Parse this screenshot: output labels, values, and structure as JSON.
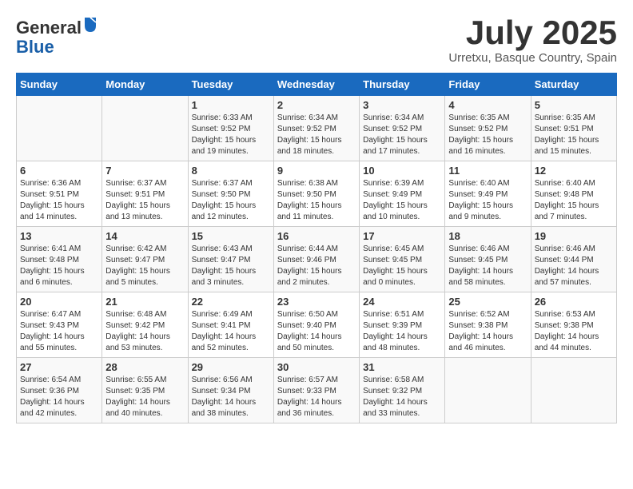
{
  "header": {
    "logo_line1": "General",
    "logo_line2": "Blue",
    "month_title": "July 2025",
    "subtitle": "Urretxu, Basque Country, Spain"
  },
  "weekdays": [
    "Sunday",
    "Monday",
    "Tuesday",
    "Wednesday",
    "Thursday",
    "Friday",
    "Saturday"
  ],
  "weeks": [
    [
      {
        "day": "",
        "sunrise": "",
        "sunset": "",
        "daylight": ""
      },
      {
        "day": "",
        "sunrise": "",
        "sunset": "",
        "daylight": ""
      },
      {
        "day": "1",
        "sunrise": "Sunrise: 6:33 AM",
        "sunset": "Sunset: 9:52 PM",
        "daylight": "Daylight: 15 hours and 19 minutes."
      },
      {
        "day": "2",
        "sunrise": "Sunrise: 6:34 AM",
        "sunset": "Sunset: 9:52 PM",
        "daylight": "Daylight: 15 hours and 18 minutes."
      },
      {
        "day": "3",
        "sunrise": "Sunrise: 6:34 AM",
        "sunset": "Sunset: 9:52 PM",
        "daylight": "Daylight: 15 hours and 17 minutes."
      },
      {
        "day": "4",
        "sunrise": "Sunrise: 6:35 AM",
        "sunset": "Sunset: 9:52 PM",
        "daylight": "Daylight: 15 hours and 16 minutes."
      },
      {
        "day": "5",
        "sunrise": "Sunrise: 6:35 AM",
        "sunset": "Sunset: 9:51 PM",
        "daylight": "Daylight: 15 hours and 15 minutes."
      }
    ],
    [
      {
        "day": "6",
        "sunrise": "Sunrise: 6:36 AM",
        "sunset": "Sunset: 9:51 PM",
        "daylight": "Daylight: 15 hours and 14 minutes."
      },
      {
        "day": "7",
        "sunrise": "Sunrise: 6:37 AM",
        "sunset": "Sunset: 9:51 PM",
        "daylight": "Daylight: 15 hours and 13 minutes."
      },
      {
        "day": "8",
        "sunrise": "Sunrise: 6:37 AM",
        "sunset": "Sunset: 9:50 PM",
        "daylight": "Daylight: 15 hours and 12 minutes."
      },
      {
        "day": "9",
        "sunrise": "Sunrise: 6:38 AM",
        "sunset": "Sunset: 9:50 PM",
        "daylight": "Daylight: 15 hours and 11 minutes."
      },
      {
        "day": "10",
        "sunrise": "Sunrise: 6:39 AM",
        "sunset": "Sunset: 9:49 PM",
        "daylight": "Daylight: 15 hours and 10 minutes."
      },
      {
        "day": "11",
        "sunrise": "Sunrise: 6:40 AM",
        "sunset": "Sunset: 9:49 PM",
        "daylight": "Daylight: 15 hours and 9 minutes."
      },
      {
        "day": "12",
        "sunrise": "Sunrise: 6:40 AM",
        "sunset": "Sunset: 9:48 PM",
        "daylight": "Daylight: 15 hours and 7 minutes."
      }
    ],
    [
      {
        "day": "13",
        "sunrise": "Sunrise: 6:41 AM",
        "sunset": "Sunset: 9:48 PM",
        "daylight": "Daylight: 15 hours and 6 minutes."
      },
      {
        "day": "14",
        "sunrise": "Sunrise: 6:42 AM",
        "sunset": "Sunset: 9:47 PM",
        "daylight": "Daylight: 15 hours and 5 minutes."
      },
      {
        "day": "15",
        "sunrise": "Sunrise: 6:43 AM",
        "sunset": "Sunset: 9:47 PM",
        "daylight": "Daylight: 15 hours and 3 minutes."
      },
      {
        "day": "16",
        "sunrise": "Sunrise: 6:44 AM",
        "sunset": "Sunset: 9:46 PM",
        "daylight": "Daylight: 15 hours and 2 minutes."
      },
      {
        "day": "17",
        "sunrise": "Sunrise: 6:45 AM",
        "sunset": "Sunset: 9:45 PM",
        "daylight": "Daylight: 15 hours and 0 minutes."
      },
      {
        "day": "18",
        "sunrise": "Sunrise: 6:46 AM",
        "sunset": "Sunset: 9:45 PM",
        "daylight": "Daylight: 14 hours and 58 minutes."
      },
      {
        "day": "19",
        "sunrise": "Sunrise: 6:46 AM",
        "sunset": "Sunset: 9:44 PM",
        "daylight": "Daylight: 14 hours and 57 minutes."
      }
    ],
    [
      {
        "day": "20",
        "sunrise": "Sunrise: 6:47 AM",
        "sunset": "Sunset: 9:43 PM",
        "daylight": "Daylight: 14 hours and 55 minutes."
      },
      {
        "day": "21",
        "sunrise": "Sunrise: 6:48 AM",
        "sunset": "Sunset: 9:42 PM",
        "daylight": "Daylight: 14 hours and 53 minutes."
      },
      {
        "day": "22",
        "sunrise": "Sunrise: 6:49 AM",
        "sunset": "Sunset: 9:41 PM",
        "daylight": "Daylight: 14 hours and 52 minutes."
      },
      {
        "day": "23",
        "sunrise": "Sunrise: 6:50 AM",
        "sunset": "Sunset: 9:40 PM",
        "daylight": "Daylight: 14 hours and 50 minutes."
      },
      {
        "day": "24",
        "sunrise": "Sunrise: 6:51 AM",
        "sunset": "Sunset: 9:39 PM",
        "daylight": "Daylight: 14 hours and 48 minutes."
      },
      {
        "day": "25",
        "sunrise": "Sunrise: 6:52 AM",
        "sunset": "Sunset: 9:38 PM",
        "daylight": "Daylight: 14 hours and 46 minutes."
      },
      {
        "day": "26",
        "sunrise": "Sunrise: 6:53 AM",
        "sunset": "Sunset: 9:38 PM",
        "daylight": "Daylight: 14 hours and 44 minutes."
      }
    ],
    [
      {
        "day": "27",
        "sunrise": "Sunrise: 6:54 AM",
        "sunset": "Sunset: 9:36 PM",
        "daylight": "Daylight: 14 hours and 42 minutes."
      },
      {
        "day": "28",
        "sunrise": "Sunrise: 6:55 AM",
        "sunset": "Sunset: 9:35 PM",
        "daylight": "Daylight: 14 hours and 40 minutes."
      },
      {
        "day": "29",
        "sunrise": "Sunrise: 6:56 AM",
        "sunset": "Sunset: 9:34 PM",
        "daylight": "Daylight: 14 hours and 38 minutes."
      },
      {
        "day": "30",
        "sunrise": "Sunrise: 6:57 AM",
        "sunset": "Sunset: 9:33 PM",
        "daylight": "Daylight: 14 hours and 36 minutes."
      },
      {
        "day": "31",
        "sunrise": "Sunrise: 6:58 AM",
        "sunset": "Sunset: 9:32 PM",
        "daylight": "Daylight: 14 hours and 33 minutes."
      },
      {
        "day": "",
        "sunrise": "",
        "sunset": "",
        "daylight": ""
      },
      {
        "day": "",
        "sunrise": "",
        "sunset": "",
        "daylight": ""
      }
    ]
  ]
}
